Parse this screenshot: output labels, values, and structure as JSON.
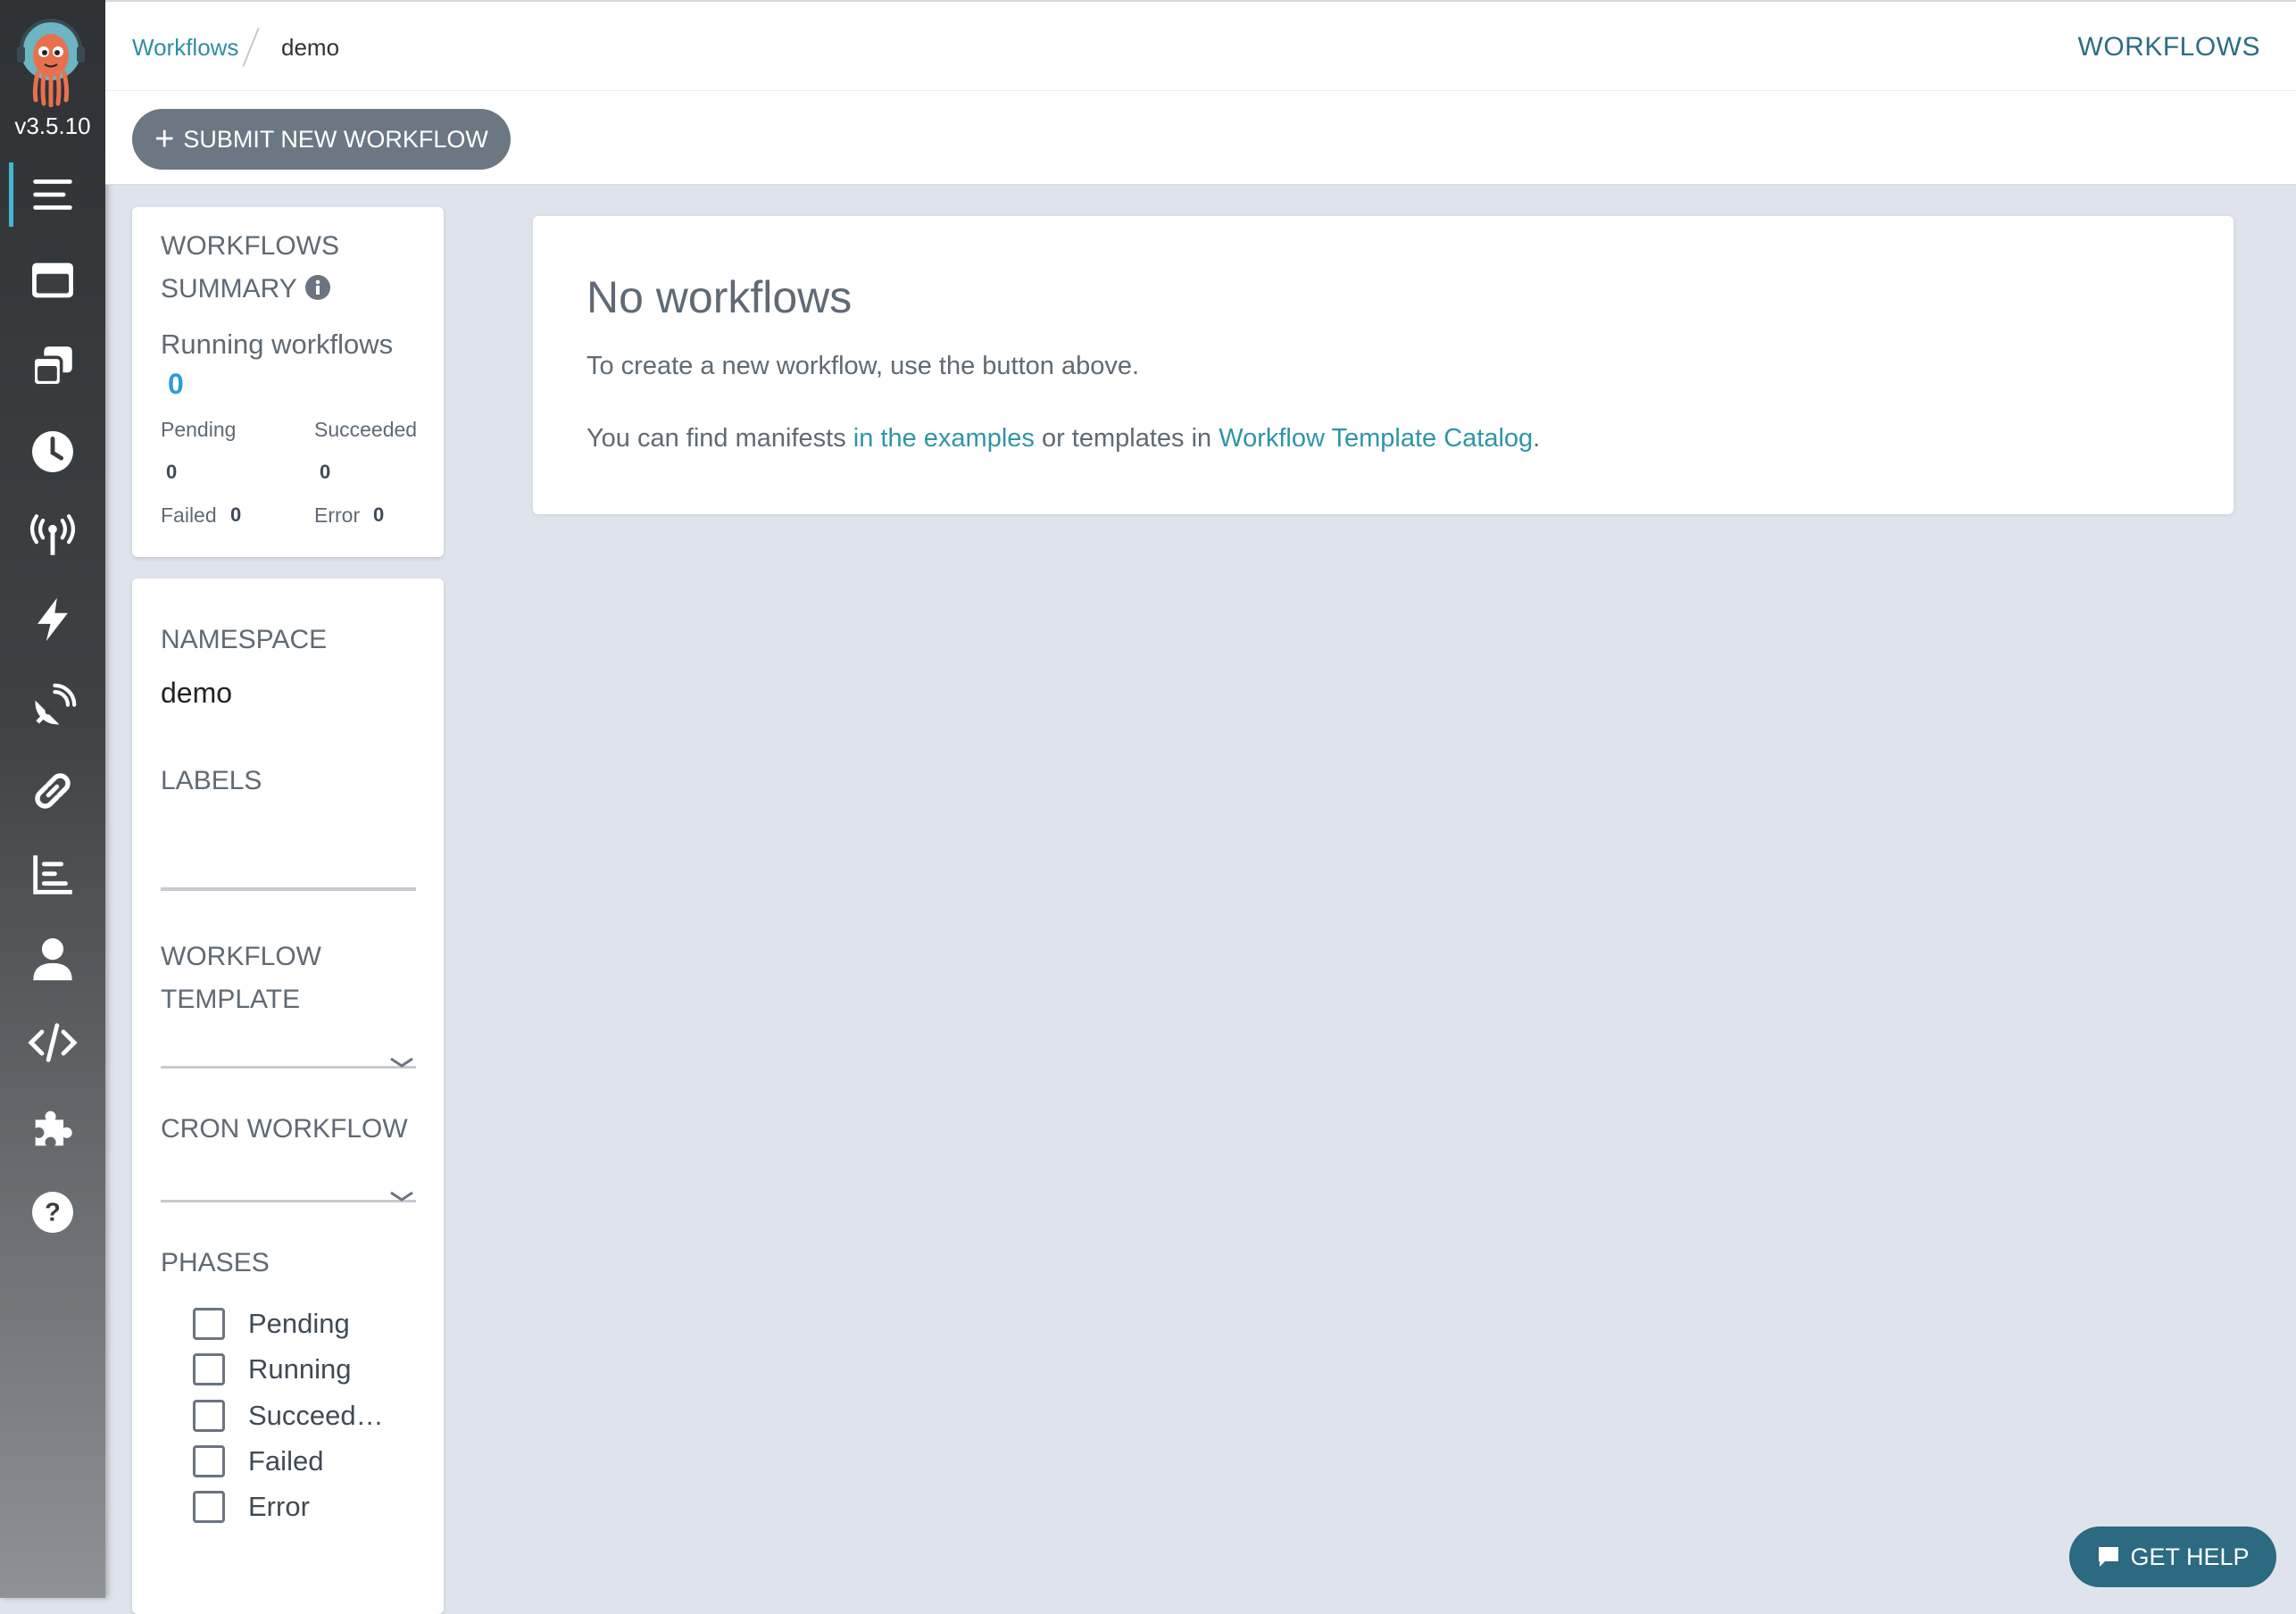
{
  "nav": {
    "version": "v3.5.10",
    "items": [
      {
        "icon": "list-icon",
        "active": true
      },
      {
        "icon": "window-icon"
      },
      {
        "icon": "copy-icon"
      },
      {
        "icon": "clock-icon"
      },
      {
        "icon": "broadcast-tower-icon"
      },
      {
        "icon": "bolt-icon"
      },
      {
        "icon": "satellite-dish-icon"
      },
      {
        "icon": "link-icon"
      },
      {
        "icon": "chart-bar-icon"
      },
      {
        "icon": "user-icon"
      },
      {
        "icon": "code-icon"
      },
      {
        "icon": "puzzle-piece-icon"
      },
      {
        "icon": "question-circle-icon"
      }
    ]
  },
  "header": {
    "breadcrumb_link": "Workflows",
    "breadcrumb_current": "demo",
    "title": "WORKFLOWS"
  },
  "toolbar": {
    "submit_label": "SUBMIT NEW WORKFLOW"
  },
  "summary": {
    "title_line1": "WORKFLOWS",
    "title_line2": "SUMMARY",
    "running_label": "Running workflows",
    "running_count": "0",
    "pending_label": "Pending",
    "pending_count": "0",
    "succeeded_label": "Succeeded",
    "succeeded_count": "0",
    "failed_label": "Failed",
    "failed_count": "0",
    "error_label": "Error",
    "error_count": "0"
  },
  "filters": {
    "namespace_label": "NAMESPACE",
    "namespace_value": "demo",
    "labels_label": "LABELS",
    "workflow_template_line1": "WORKFLOW",
    "workflow_template_line2": "TEMPLATE",
    "cron_workflow_label": "CRON WORKFLOW",
    "phases_label": "PHASES",
    "phases": [
      "Pending",
      "Running",
      "Succeed…",
      "Failed",
      "Error"
    ]
  },
  "empty": {
    "title": "No workflows",
    "line1": "To create a new workflow, use the button above.",
    "line2_prefix": "You can find manifests ",
    "examples_link": "in the examples",
    "line2_middle": " or templates in ",
    "catalog_link": "Workflow Template Catalog",
    "line2_suffix": "."
  },
  "help": {
    "label": "GET HELP"
  }
}
